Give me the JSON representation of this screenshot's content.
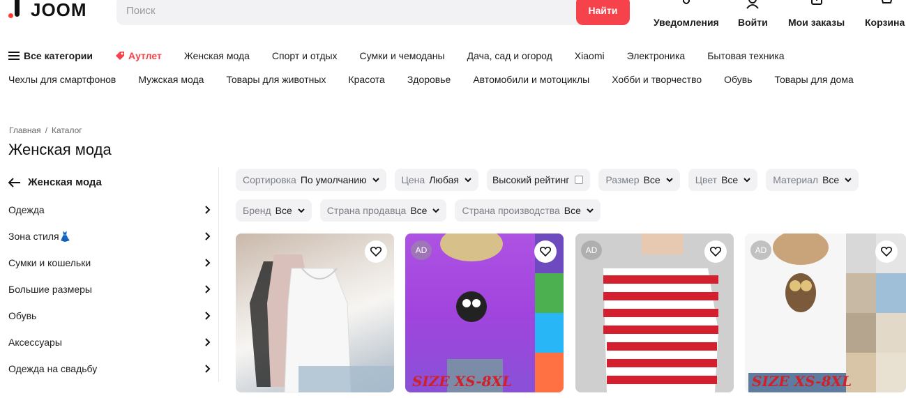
{
  "header": {
    "logo_text": "JOOM",
    "search_placeholder": "Поиск",
    "search_button": "Найти",
    "actions": [
      "Уведомления",
      "Войти",
      "Мои заказы",
      "Корзина"
    ]
  },
  "nav": {
    "row1": [
      "Все категории",
      "Аутлет",
      "Женская мода",
      "Спорт и отдых",
      "Сумки и чемоданы",
      "Дача, сад и огород",
      "Xiaomi",
      "Электроника",
      "Бытовая техника"
    ],
    "row2": [
      "Чехлы для смартфонов",
      "Мужская мода",
      "Товары для животных",
      "Красота",
      "Здоровье",
      "Автомобили и мотоциклы",
      "Хобби и творчество",
      "Обувь",
      "Товары для дома"
    ]
  },
  "breadcrumb": [
    "Главная",
    "Каталог"
  ],
  "page_title": "Женская мода",
  "sidebar": {
    "back_label": "Женская мода",
    "items": [
      "Одежда",
      "Зона стиля👗",
      "Сумки и кошельки",
      "Большие размеры",
      "Обувь",
      "Аксессуары",
      "Одежда на свадьбу"
    ]
  },
  "filters": {
    "sort": {
      "label": "Сортировка",
      "value": "По умолчанию"
    },
    "price": {
      "label": "Цена",
      "value": "Любая"
    },
    "rating": {
      "label": "Высокий рейтинг"
    },
    "size": {
      "label": "Размер",
      "value": "Все"
    },
    "color": {
      "label": "Цвет",
      "value": "Все"
    },
    "material": {
      "label": "Материал",
      "value": "Все"
    },
    "brand": {
      "label": "Бренд",
      "value": "Все"
    },
    "seller_country": {
      "label": "Страна продавца",
      "value": "Все"
    },
    "made_in": {
      "label": "Страна производства",
      "value": "Все"
    }
  },
  "products": [
    {
      "ad": "",
      "size_text": ""
    },
    {
      "ad": "AD",
      "size_text": "SIZE XS-8XL"
    },
    {
      "ad": "AD",
      "size_text": ""
    },
    {
      "ad": "AD",
      "size_text": "SIZE XS-8XL"
    }
  ],
  "colors": {
    "accent": "#f5424b",
    "chip_bg": "#f2f2f5"
  }
}
